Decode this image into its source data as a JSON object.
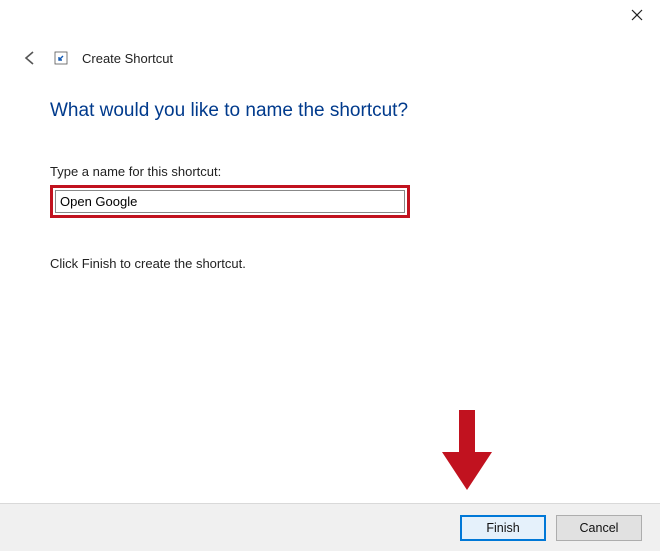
{
  "window": {
    "close_tooltip": "Close"
  },
  "header": {
    "title": "Create Shortcut"
  },
  "wizard": {
    "heading": "What would you like to name the shortcut?",
    "prompt": "Type a name for this shortcut:",
    "name_value": "Open Google",
    "hint": "Click Finish to create the shortcut."
  },
  "buttons": {
    "finish": "Finish",
    "cancel": "Cancel"
  },
  "annotation": {
    "arrow_color": "#c1121f"
  }
}
